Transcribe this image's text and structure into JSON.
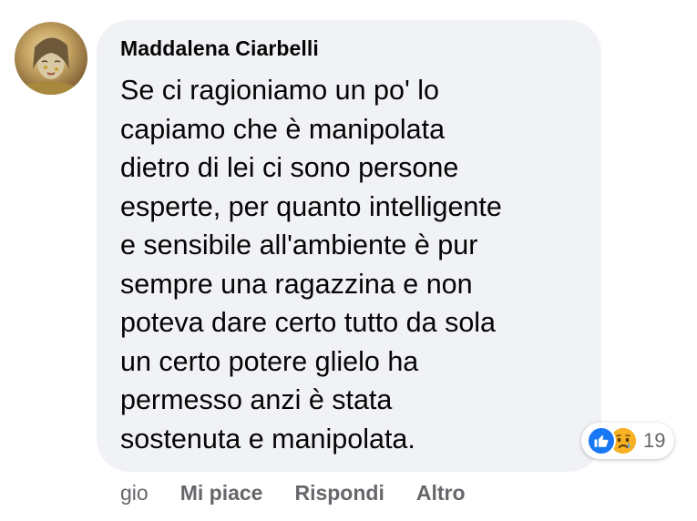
{
  "comment": {
    "author": "Maddalena Ciarbelli",
    "text_lines": [
      "Se ci ragioniamo un po' lo",
      "capiamo che è manipolata",
      "dietro di lei ci sono persone",
      "esperte, per quanto intelligente",
      "e sensibile all'ambiente è pur",
      "sempre una ragazzina e non",
      "poteva dare certo tutto da sola",
      "un certo potere glielo ha",
      "permesso anzi è stata",
      "sostenuta e manipolata."
    ],
    "reactions": {
      "icons": [
        "like-icon",
        "sad-icon"
      ],
      "count": "19"
    }
  },
  "actions": {
    "time": "gio",
    "like_label": "Mi piace",
    "reply_label": "Rispondi",
    "more_label": "Altro"
  },
  "colors": {
    "bubble_bg": "#f0f2f5",
    "text": "#050505",
    "secondary_text": "#65676b",
    "like_blue": "#1877f2",
    "sad_yellow": "#f7b125"
  }
}
